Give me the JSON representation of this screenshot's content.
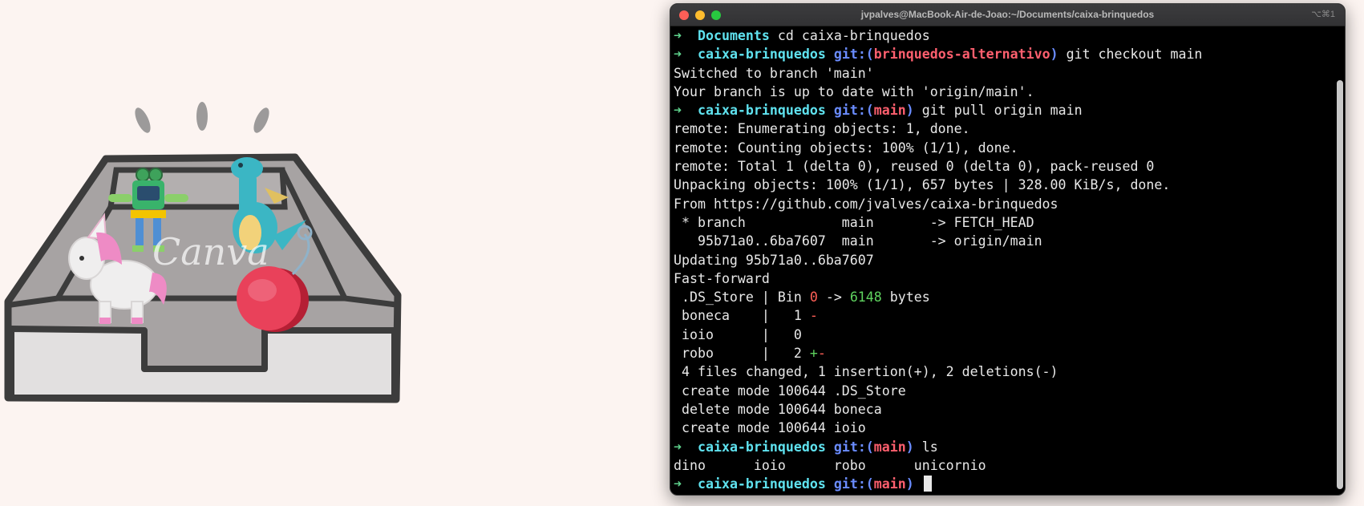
{
  "window": {
    "title": "jvpalves@MacBook-Air-de-Joao:~/Documents/caixa-brinquedos",
    "shortcut": "⌥⌘1"
  },
  "illustration": {
    "watermark": "Canva"
  },
  "terminal": {
    "lines": [
      {
        "type": "prompt",
        "arrow": "➜",
        "dir": "Documents",
        "cmd": " cd caixa-brinquedos"
      },
      {
        "type": "prompt_git",
        "arrow": "➜",
        "dir": "caixa-brinquedos",
        "git": "git:(",
        "branch": "brinquedos-alternativo",
        "close": ")",
        "cmd": " git checkout main"
      },
      {
        "type": "text",
        "text": "Switched to branch 'main'"
      },
      {
        "type": "text",
        "text": "Your branch is up to date with 'origin/main'."
      },
      {
        "type": "prompt_git",
        "arrow": "➜",
        "dir": "caixa-brinquedos",
        "git": "git:(",
        "branch": "main",
        "close": ")",
        "cmd": " git pull origin main"
      },
      {
        "type": "text",
        "text": "remote: Enumerating objects: 1, done."
      },
      {
        "type": "text",
        "text": "remote: Counting objects: 100% (1/1), done."
      },
      {
        "type": "text",
        "text": "remote: Total 1 (delta 0), reused 0 (delta 0), pack-reused 0"
      },
      {
        "type": "text",
        "text": "Unpacking objects: 100% (1/1), 657 bytes | 328.00 KiB/s, done."
      },
      {
        "type": "text",
        "text": "From https://github.com/jvalves/caixa-brinquedos"
      },
      {
        "type": "text",
        "text": " * branch            main       -> FETCH_HEAD"
      },
      {
        "type": "text",
        "text": "   95b71a0..6ba7607  main       -> origin/main"
      },
      {
        "type": "text",
        "text": "Updating 95b71a0..6ba7607"
      },
      {
        "type": "text",
        "text": "Fast-forward"
      },
      {
        "type": "bin",
        "pre": " .DS_Store | Bin ",
        "a": "0",
        "mid": " -> ",
        "b": "6148",
        "post": " bytes"
      },
      {
        "type": "stat",
        "pre": " boneca    |   1 ",
        "plus": "",
        "minus": "-"
      },
      {
        "type": "stat",
        "pre": " ioio      |   0",
        "plus": "",
        "minus": ""
      },
      {
        "type": "stat",
        "pre": " robo      |   2 ",
        "plus": "+",
        "minus": "-"
      },
      {
        "type": "text",
        "text": " 4 files changed, 1 insertion(+), 2 deletions(-)"
      },
      {
        "type": "text",
        "text": " create mode 100644 .DS_Store"
      },
      {
        "type": "text",
        "text": " delete mode 100644 boneca"
      },
      {
        "type": "text",
        "text": " create mode 100644 ioio"
      },
      {
        "type": "prompt_git",
        "arrow": "➜",
        "dir": "caixa-brinquedos",
        "git": "git:(",
        "branch": "main",
        "close": ")",
        "cmd": " ls"
      },
      {
        "type": "text",
        "text": "dino      ioio      robo      unicornio"
      },
      {
        "type": "prompt_git",
        "arrow": "➜",
        "dir": "caixa-brinquedos",
        "git": "git:(",
        "branch": "main",
        "close": ")",
        "cmd": " ",
        "cursor": true
      }
    ]
  }
}
